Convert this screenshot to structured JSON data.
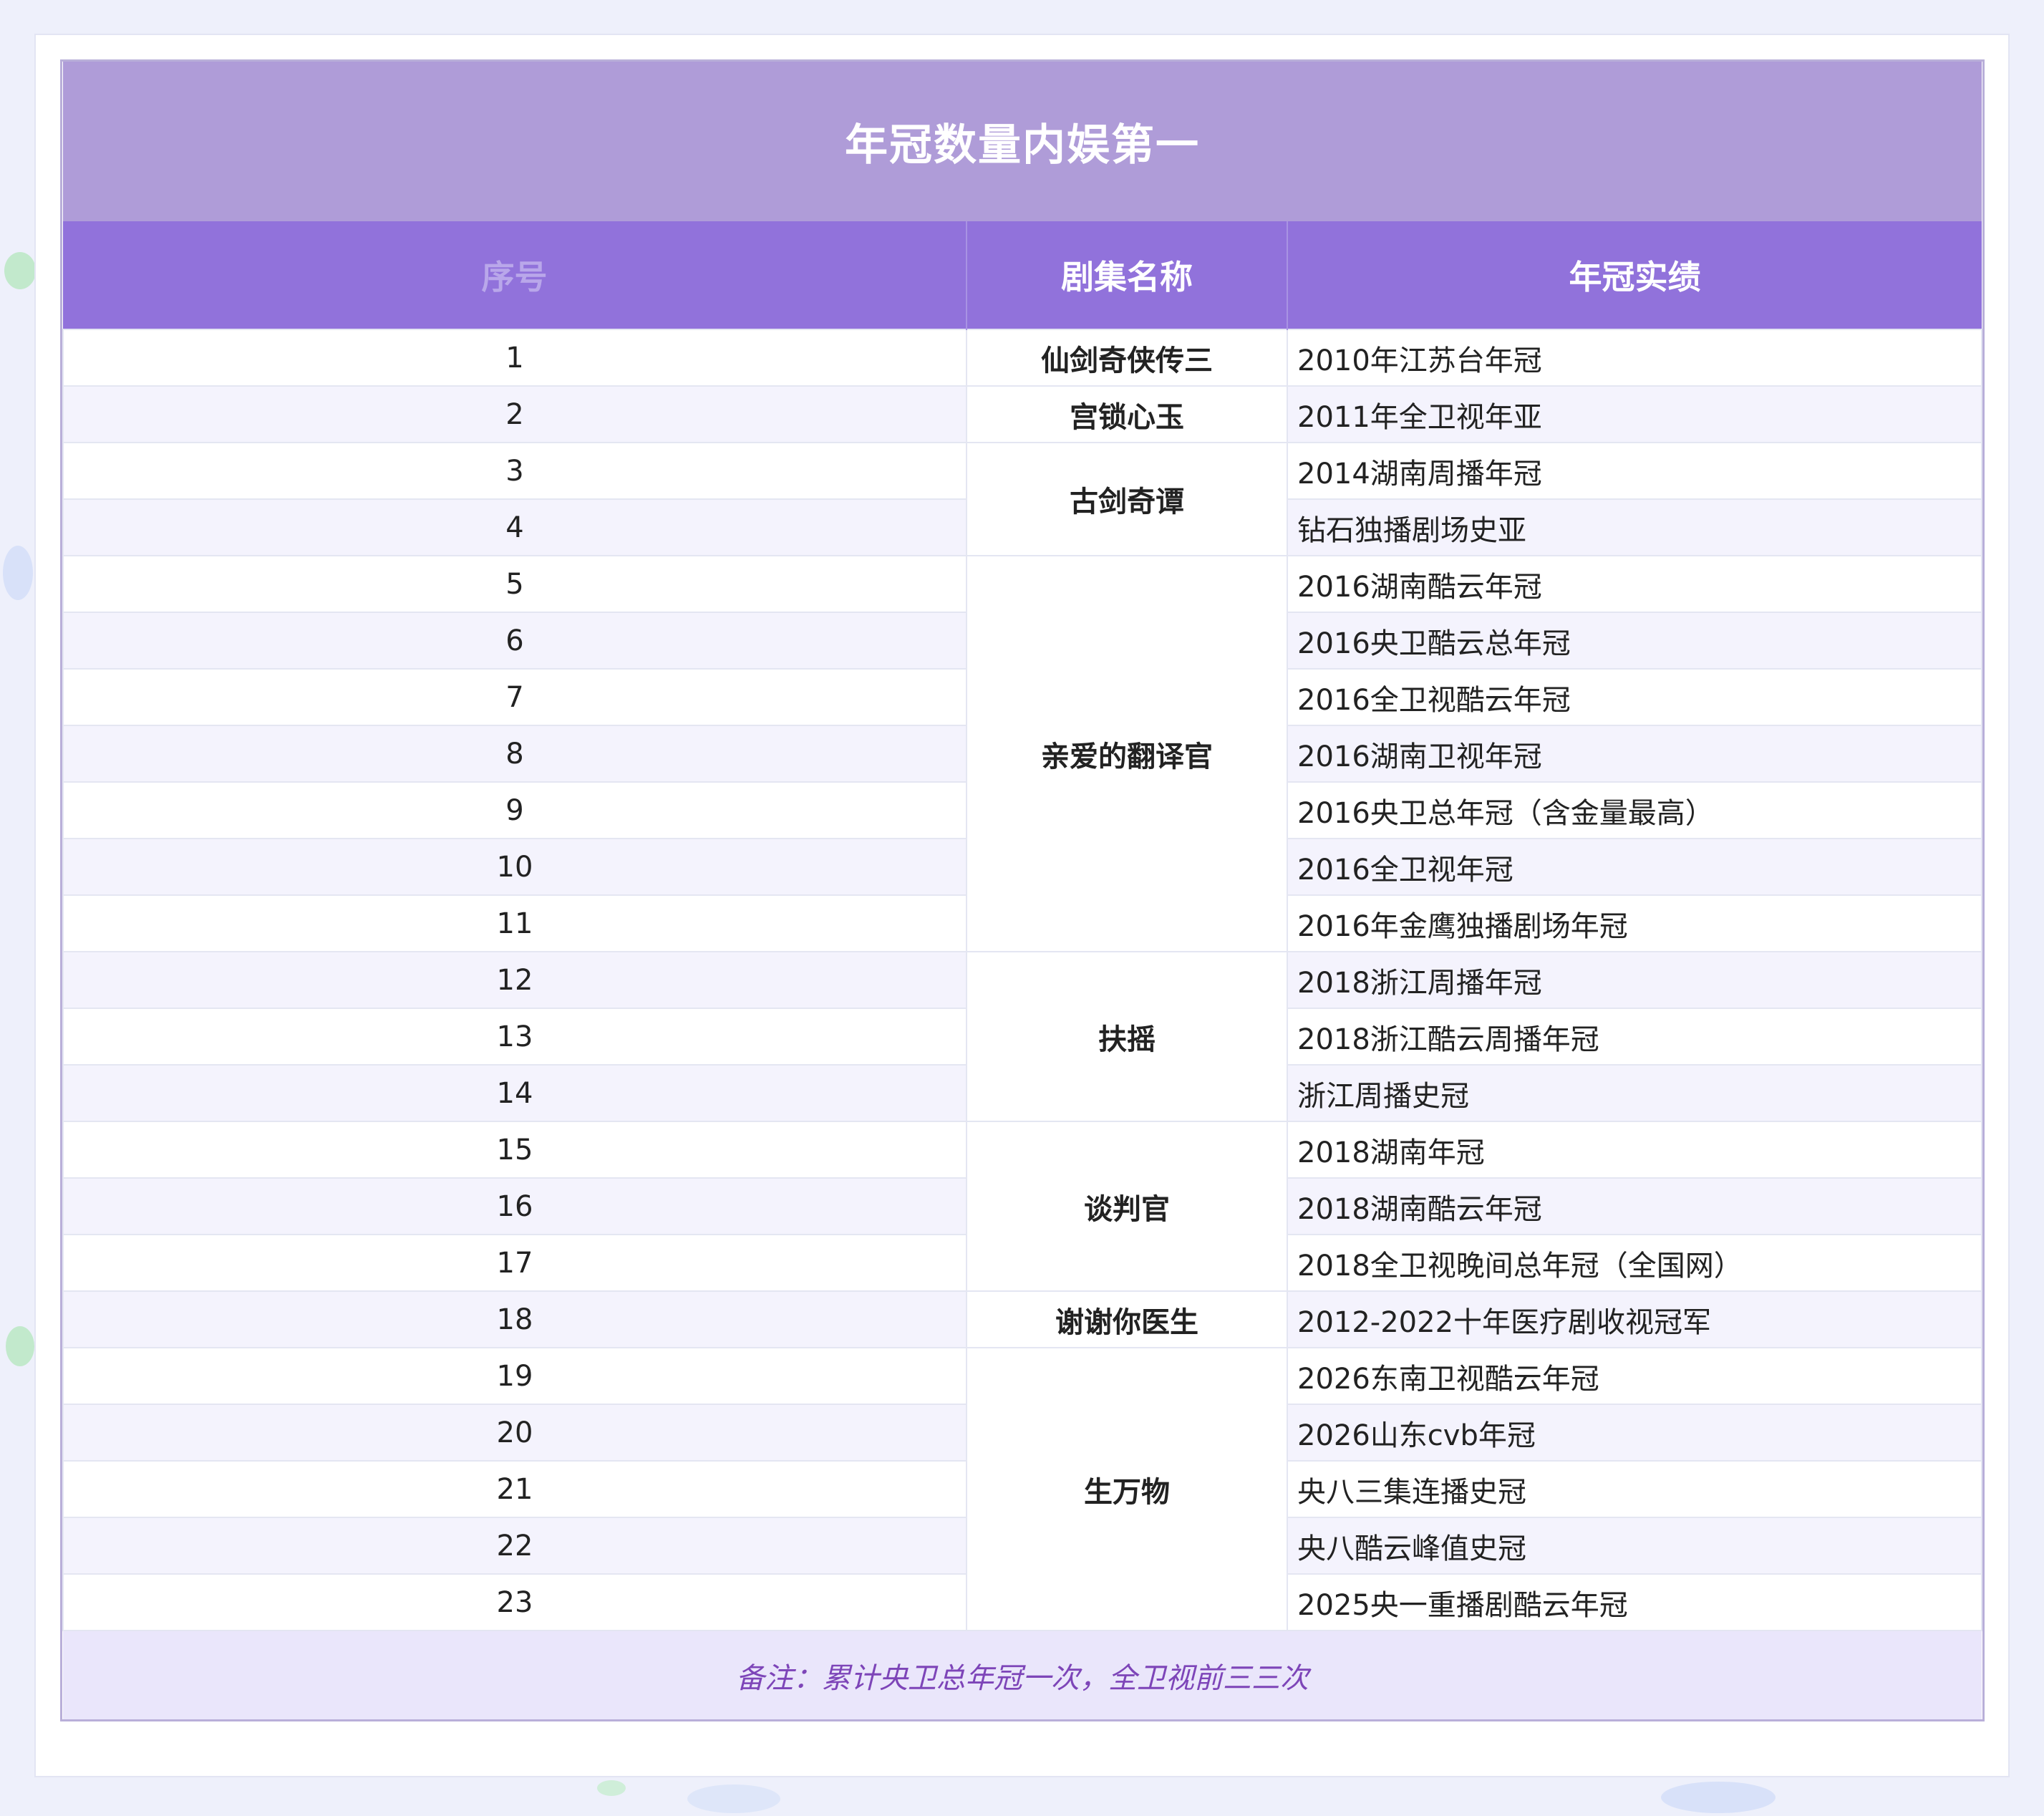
{
  "table": {
    "title": "年冠数量内娱第一",
    "headers": [
      "序号",
      "剧集名称",
      "年冠实绩"
    ],
    "rows": [
      {
        "index": "1",
        "achievement": "2010年江苏台年冠"
      },
      {
        "index": "2",
        "achievement": "2011年全卫视年亚"
      },
      {
        "index": "3",
        "achievement": "2014湖南周播年冠"
      },
      {
        "index": "4",
        "achievement": "钻石独播剧场史亚"
      },
      {
        "index": "5",
        "achievement": "2016湖南酷云年冠"
      },
      {
        "index": "6",
        "achievement": "2016央卫酷云总年冠"
      },
      {
        "index": "7",
        "achievement": "2016全卫视酷云年冠"
      },
      {
        "index": "8",
        "achievement": "2016湖南卫视年冠"
      },
      {
        "index": "9",
        "achievement": "2016央卫总年冠（含金量最高）"
      },
      {
        "index": "10",
        "achievement": "2016全卫视年冠"
      },
      {
        "index": "11",
        "achievement": "2016年金鹰独播剧场年冠"
      },
      {
        "index": "12",
        "achievement": "2018浙江周播年冠"
      },
      {
        "index": "13",
        "achievement": "2018浙江酷云周播年冠"
      },
      {
        "index": "14",
        "achievement": "浙江周播史冠"
      },
      {
        "index": "15",
        "achievement": "2018湖南年冠"
      },
      {
        "index": "16",
        "achievement": "2018湖南酷云年冠"
      },
      {
        "index": "17",
        "achievement": "2018全卫视晚间总年冠（全国网）"
      },
      {
        "index": "18",
        "achievement": "2012-2022十年医疗剧收视冠军"
      },
      {
        "index": "19",
        "achievement": "2026东南卫视酷云年冠"
      },
      {
        "index": "20",
        "achievement": "2026山东cvb年冠"
      },
      {
        "index": "21",
        "achievement": "央八三集连播史冠"
      },
      {
        "index": "22",
        "achievement": "央八酷云峰值史冠"
      },
      {
        "index": "23",
        "achievement": "2025央一重播剧酷云年冠"
      }
    ],
    "dramas": [
      {
        "name": "仙剑奇侠传三",
        "span": 1
      },
      {
        "name": "宫锁心玉",
        "span": 1
      },
      {
        "name": "古剑奇谭",
        "span": 2
      },
      {
        "name": "亲爱的翻译官",
        "span": 7
      },
      {
        "name": "扶摇",
        "span": 3
      },
      {
        "name": "谈判官",
        "span": 3
      },
      {
        "name": "谢谢你医生",
        "span": 1
      },
      {
        "name": "生万物",
        "span": 5
      }
    ],
    "footnote": "备注：累计央卫总年冠一次，全卫视前三三次"
  },
  "colors": {
    "title_bg": "#af9cd8",
    "header_bg": "#9172db",
    "stripe_bg": "#f4f3fd",
    "footnote_bg": "#eae6fb",
    "footnote_text": "#7d45b8",
    "page_bg": "#eef0fb"
  }
}
